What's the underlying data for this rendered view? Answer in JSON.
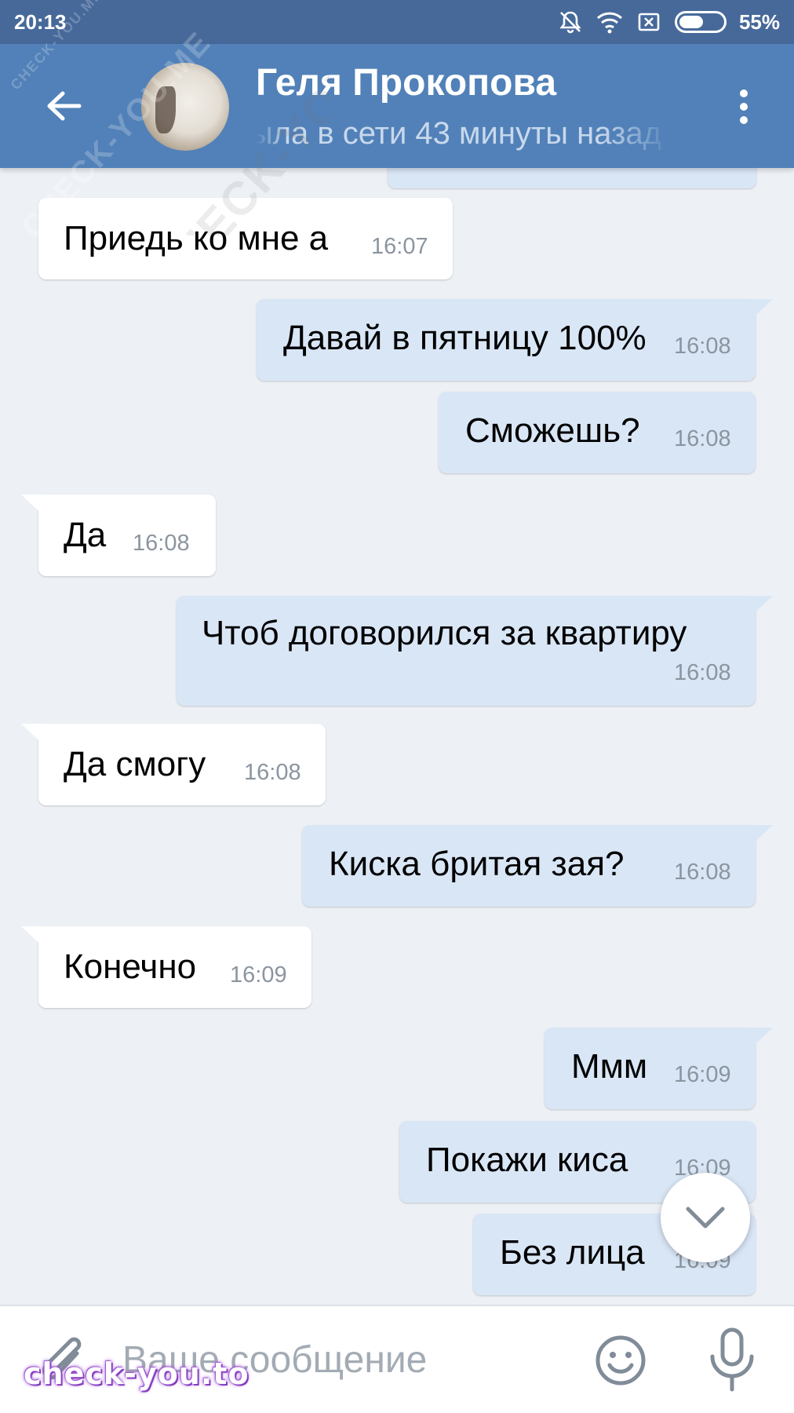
{
  "status_bar": {
    "time": "20:13",
    "battery": "55%",
    "battery_level": 0.55
  },
  "header": {
    "contact_name": "Геля Прокопова",
    "contact_status": "была в сети 43 минуты назад"
  },
  "watermark": {
    "text": "CHECK-YOU.ME"
  },
  "messages": [
    {
      "direction": "in",
      "text": "Приедь ко мне а",
      "time": "16:07"
    },
    {
      "direction": "out",
      "text": "Давай в пятницу 100%",
      "time": "16:08"
    },
    {
      "direction": "out",
      "text": "Сможешь?",
      "time": "16:08"
    },
    {
      "direction": "in",
      "text": "Да",
      "time": "16:08"
    },
    {
      "direction": "out",
      "text": "Чтоб договорился за квартиру",
      "time": "16:08"
    },
    {
      "direction": "in",
      "text": "Да смогу",
      "time": "16:08"
    },
    {
      "direction": "out",
      "text": "Киска бритая зая?",
      "time": "16:08"
    },
    {
      "direction": "in",
      "text": "Конечно",
      "time": "16:09"
    },
    {
      "direction": "out",
      "text": "Ммм",
      "time": "16:09"
    },
    {
      "direction": "out",
      "text": "Покажи киса",
      "time": "16:09"
    },
    {
      "direction": "out",
      "text": "Без лица",
      "time": "16:09"
    }
  ],
  "input_bar": {
    "placeholder": "Ваше сообщение"
  },
  "site_watermark": "check-you.to",
  "colors": {
    "header_bg": "#5181b8",
    "statusbar_bg": "#47699a",
    "chat_bg": "#edf1f6",
    "incoming_bubble": "#ffffff",
    "outgoing_bubble": "#d9e6f6",
    "timestamp": "#8b959f",
    "icon_gray": "#818c99"
  },
  "icons": [
    "back-arrow-icon",
    "more-vertical-icon",
    "mute-icon",
    "wifi-icon",
    "no-sim-icon",
    "battery-icon",
    "chevron-down-icon",
    "paperclip-icon",
    "emoji-icon",
    "microphone-icon"
  ]
}
